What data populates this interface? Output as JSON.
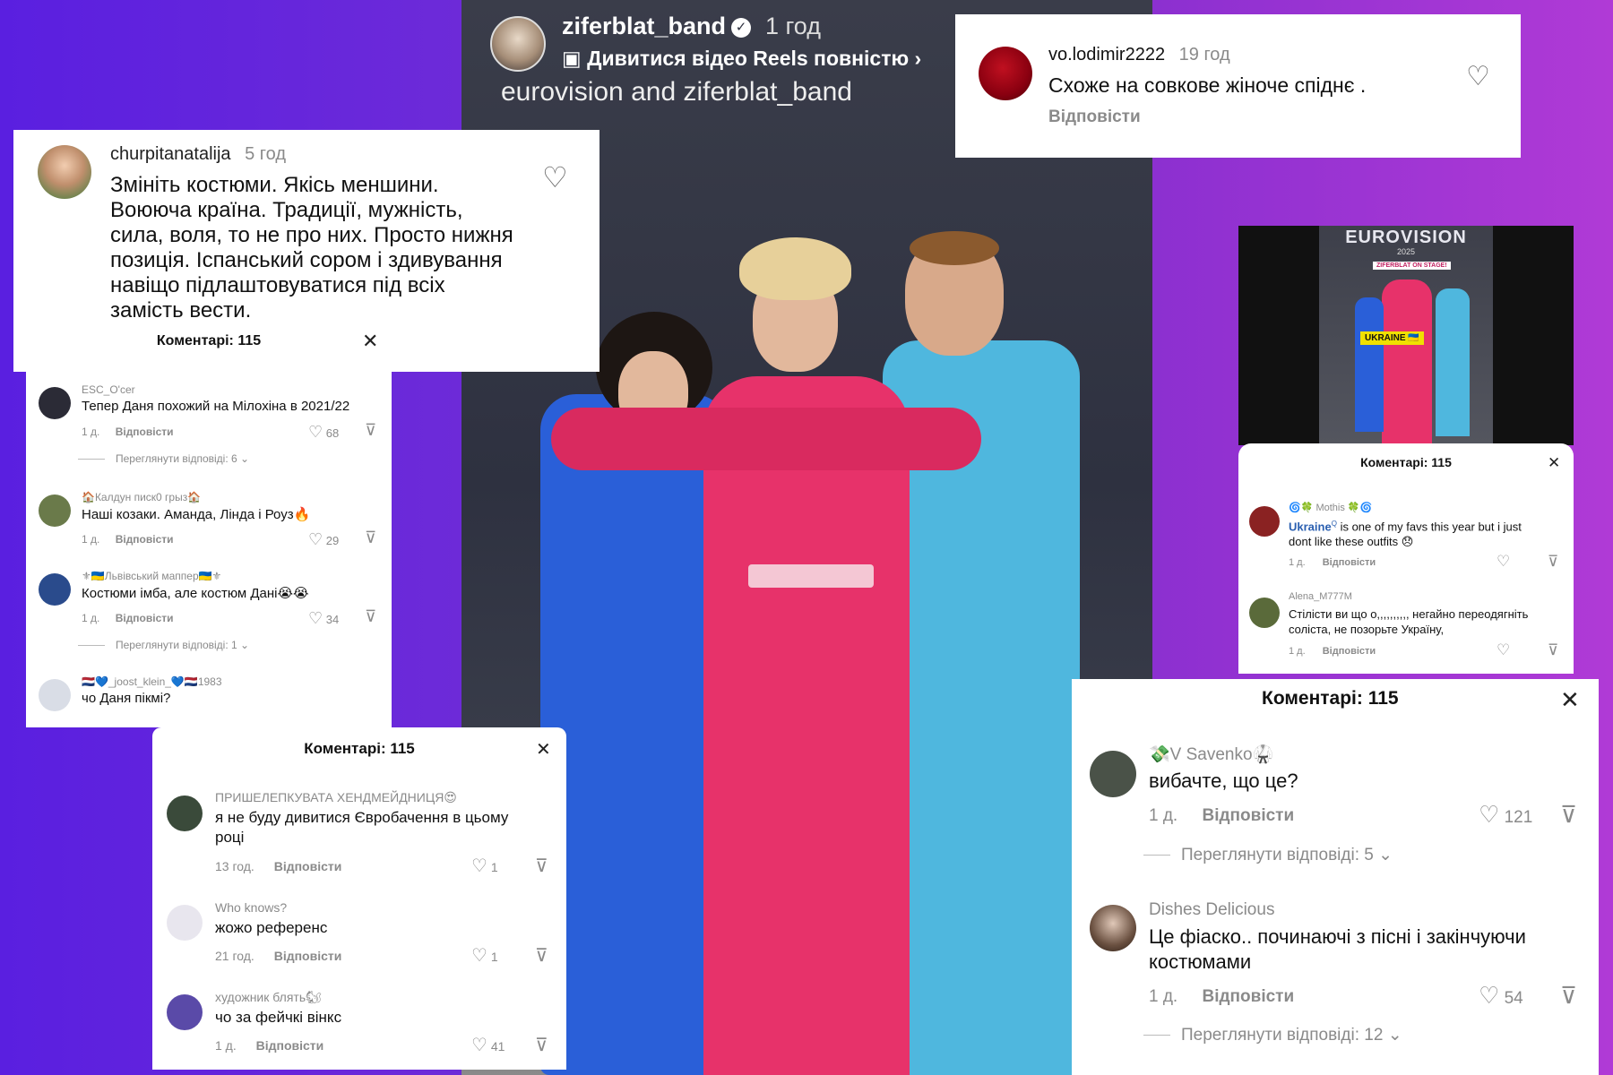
{
  "reel": {
    "username": "ziferblat_band",
    "time": "1 год",
    "watch_label": "Дивитися відео Reels повністю",
    "collab": "eurovision and ziferblat_band"
  },
  "card_churpita": {
    "user": "churpitanatalija",
    "time": "5 год",
    "lines": [
      "Змініть костюми. Якісь меншини.",
      "Воююча країна. Традиції, мужність,",
      "сила, воля, то не про них. Просто нижня",
      "позиція. Іспанський сором і здивування",
      "навіщо підлаштовуватися під всіх",
      "замість вести."
    ]
  },
  "card_vo": {
    "user": "vo.lodimir2222",
    "time": "19 год",
    "text": "Схоже на совкове жіноче спіднє .",
    "reply": "Відповісти"
  },
  "sheet_left": {
    "title": "Коментарі: 115",
    "comments": [
      {
        "user": "ESC_O'cer",
        "text": "Тепер Даня похожий на Мілохіна в 2021/22",
        "time": "1 д.",
        "reply": "Відповісти",
        "likes": "68",
        "view_replies": "Переглянути відповіді: 6"
      },
      {
        "user": "🏠Калдун писк0 грыз🏠",
        "text": "Наші козаки. Аманда, Лінда і Роуз🔥",
        "time": "1 д.",
        "reply": "Відповісти",
        "likes": "29",
        "view_replies": ""
      },
      {
        "user": "⚜🇺🇦Львівський маппер🇺🇦⚜",
        "text": "Костюми імба, але костюм Дані😭😭",
        "time": "1 д.",
        "reply": "Відповісти",
        "likes": "34",
        "view_replies": "Переглянути відповіді: 1"
      },
      {
        "user": "🇳🇱💙_joost_klein_💙🇳🇱1983",
        "text": "чо Даня пікмі?"
      }
    ]
  },
  "sheet_bottom_left": {
    "title": "Коментарі: 115",
    "comments": [
      {
        "user": "ПРИШЕЛЕПКУВАТА ХЕНДМЕЙДНИЦЯ😍",
        "text_lines": [
          "я не буду дивитися Євробачення в цьому",
          "році"
        ],
        "time": "13 год.",
        "reply": "Відповісти",
        "likes": "1"
      },
      {
        "user": "Who knows?",
        "text_lines": [
          "жожо референс"
        ],
        "time": "21 год.",
        "reply": "Відповісти",
        "likes": "1"
      },
      {
        "user": "художник блять🐿",
        "text_lines": [
          "чо за фейчкі вінкс"
        ],
        "time": "1 д.",
        "reply": "Відповісти",
        "likes": "41"
      }
    ]
  },
  "sheet_right_small": {
    "thumb_title": "EUROVISION",
    "thumb_year": "2025",
    "thumb_sub": "ZIFERBLAT ON STAGE!",
    "thumb_country": "UKRAINE 🇺🇦",
    "title": "Коментарі: 115",
    "comments": [
      {
        "user": "🌀🍀 Mothis 🍀🌀",
        "mention": "Ukraine",
        "text_lines": [
          "is one of my favs this year but i just",
          "dont like these outfits 😞"
        ],
        "time": "1 д.",
        "reply": "Відповісти"
      },
      {
        "user": "Alena_M777M",
        "text_lines": [
          "Стілісти ви що о,,,,,,,,,, негайно переодягніть",
          "соліста, не позорьте Україну,"
        ],
        "time": "1 д.",
        "reply": "Відповісти"
      }
    ]
  },
  "sheet_bottom_right": {
    "title": "Коментарі: 115",
    "comments": [
      {
        "user": "💸V Savenko🥋",
        "text_lines": [
          "вибачте, що це?"
        ],
        "time": "1 д.",
        "reply": "Відповісти",
        "likes": "121",
        "view_replies": "Переглянути відповіді: 5"
      },
      {
        "user": "Dishes Delicious",
        "text_lines": [
          "Це фіаско.. починаючі з пісні і закінчуючи",
          "костюмами"
        ],
        "time": "1 д.",
        "reply": "Відповісти",
        "likes": "54",
        "view_replies": "Переглянути відповіді: 12"
      }
    ]
  }
}
